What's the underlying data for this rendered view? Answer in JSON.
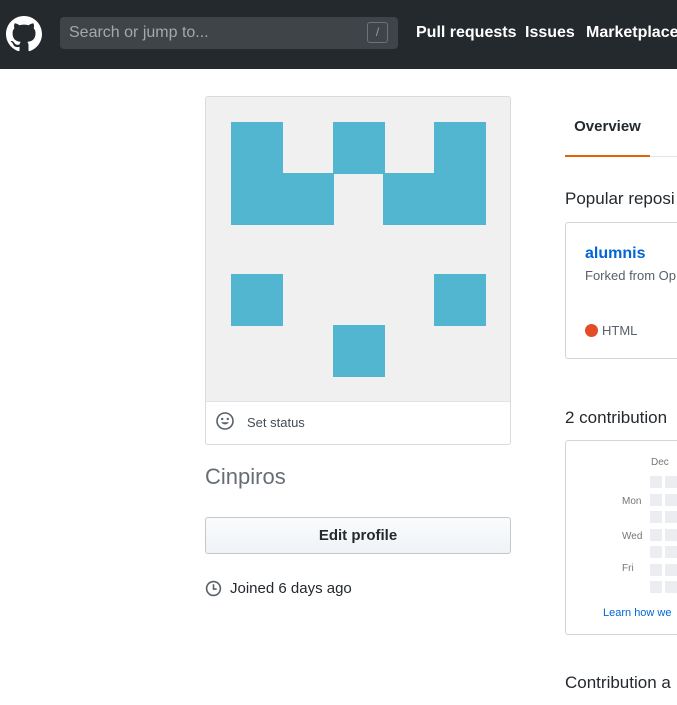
{
  "header": {
    "search_placeholder": "Search or jump to...",
    "search_shortcut": "/",
    "nav": [
      "Pull requests",
      "Issues",
      "Marketplace"
    ]
  },
  "avatar": {
    "color": "#53b6d0",
    "background": "#f0f0f0"
  },
  "profile": {
    "status_label": "Set status",
    "username": "Cinpiros",
    "edit_button": "Edit profile",
    "joined": "Joined 6 days ago"
  },
  "tabs": {
    "overview": "Overview"
  },
  "popular_repos": {
    "title": "Popular reposi",
    "repo": {
      "name": "alumnis",
      "fork_text": "Forked from Op",
      "language": "HTML",
      "language_color": "#e34c26"
    }
  },
  "contributions": {
    "title": "2 contribution",
    "month": "Dec",
    "days": [
      "Mon",
      "Wed",
      "Fri"
    ],
    "learn_link": "Learn how we"
  },
  "activity": {
    "title": "Contribution a"
  }
}
